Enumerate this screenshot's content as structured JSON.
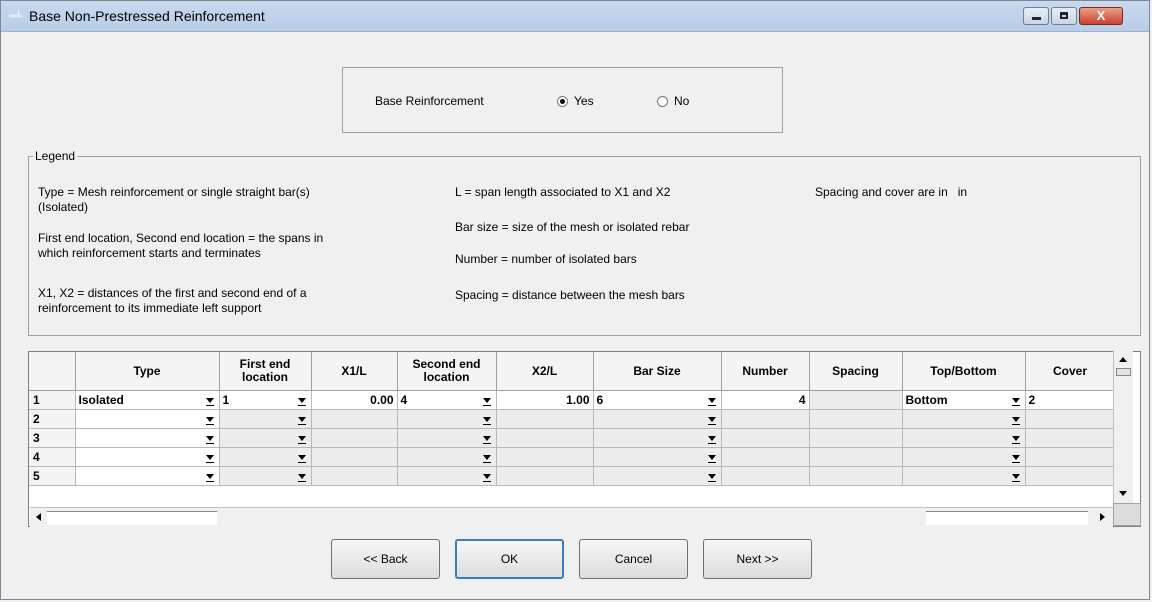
{
  "window": {
    "title": "Base Non-Prestressed Reinforcement",
    "controls": {
      "minimize": "minimize",
      "maximize": "maximize",
      "close": "X"
    }
  },
  "base_reinforcement": {
    "label": "Base Reinforcement",
    "options": [
      {
        "label": "Yes",
        "selected": true
      },
      {
        "label": "No",
        "selected": false
      }
    ]
  },
  "legend": {
    "title": "Legend",
    "col1": [
      "Type = Mesh reinforcement or single straight bar(s)",
      "(Isolated)",
      "First end location, Second end location = the spans in",
      "which reinforcement starts and terminates",
      "X1, X2 = distances of the first and second end of a",
      "reinforcement to its immediate left support"
    ],
    "col2": [
      "L = span length associated to X1 and X2",
      "Bar size = size of the mesh or isolated rebar",
      "Number = number of isolated bars",
      "Spacing = distance between the mesh bars"
    ],
    "col3": [
      "Spacing and cover are in   in"
    ]
  },
  "table": {
    "headers": [
      "Type",
      "First end location",
      "X1/L",
      "Second end location",
      "X2/L",
      "Bar Size",
      "Number",
      "Spacing",
      "Top/Bottom",
      "Cover"
    ],
    "rows": [
      {
        "row": "1",
        "type": "Isolated",
        "first_end": "1",
        "x1l": "0.00",
        "second_end": "4",
        "x2l": "1.00",
        "bar_size": "6",
        "number": "4",
        "spacing": "",
        "top_bottom": "Bottom",
        "cover": "2"
      },
      {
        "row": "2",
        "type": "",
        "first_end": "",
        "x1l": "",
        "second_end": "",
        "x2l": "",
        "bar_size": "",
        "number": "",
        "spacing": "",
        "top_bottom": "",
        "cover": ""
      },
      {
        "row": "3",
        "type": "",
        "first_end": "",
        "x1l": "",
        "second_end": "",
        "x2l": "",
        "bar_size": "",
        "number": "",
        "spacing": "",
        "top_bottom": "",
        "cover": ""
      },
      {
        "row": "4",
        "type": "",
        "first_end": "",
        "x1l": "",
        "second_end": "",
        "x2l": "",
        "bar_size": "",
        "number": "",
        "spacing": "",
        "top_bottom": "",
        "cover": ""
      },
      {
        "row": "5",
        "type": "",
        "first_end": "",
        "x1l": "",
        "second_end": "",
        "x2l": "",
        "bar_size": "",
        "number": "",
        "spacing": "",
        "top_bottom": "",
        "cover": ""
      }
    ]
  },
  "buttons": {
    "back": "<< Back",
    "ok": "OK",
    "cancel": "Cancel",
    "next": "Next >>"
  }
}
